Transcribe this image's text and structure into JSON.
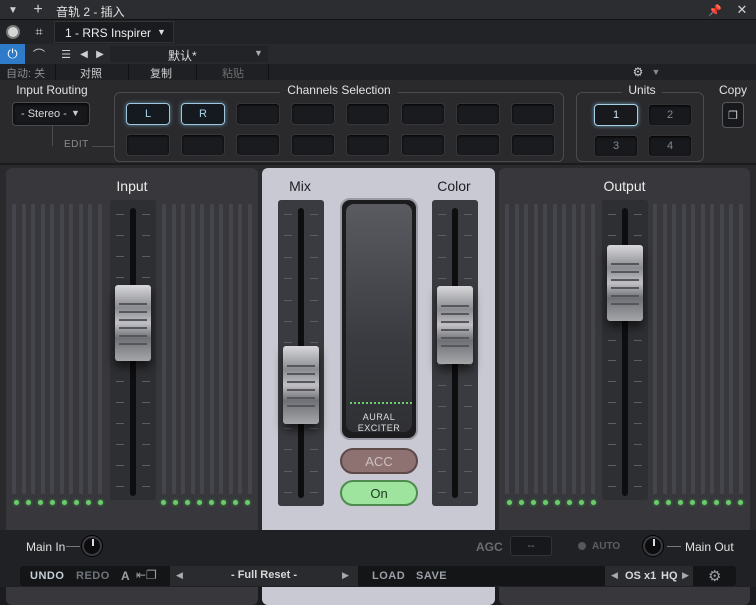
{
  "host": {
    "title": "音轨 2 - 插入",
    "plugin_slot": "1 - RRS Inspirer",
    "preset": "默认*",
    "auto_label": "自动: 关",
    "compare": "对照",
    "copy": "复制",
    "paste": "粘贴"
  },
  "plugin": {
    "input_routing": {
      "label": "Input Routing",
      "value": "- Stereo -",
      "edit": "EDIT"
    },
    "channels": {
      "label": "Channels Selection",
      "row1": [
        "L",
        "R",
        "",
        "",
        "",
        "",
        "",
        ""
      ],
      "row2": [
        "",
        "",
        "",
        "",
        "",
        "",
        "",
        ""
      ],
      "active": [
        "L",
        "R"
      ]
    },
    "units": {
      "label": "Units",
      "items": [
        "1",
        "2",
        "3",
        "4"
      ],
      "active": "1"
    },
    "copy_label": "Copy",
    "input_panel": {
      "title": "Input",
      "fader_level": 0.63
    },
    "mix": {
      "title": "Mix",
      "fader_level": 0.35
    },
    "color": {
      "title": "Color",
      "fader_level": 0.63
    },
    "exciter": {
      "line1": "AURAL",
      "line2": "EXCITER",
      "acc": "ACC",
      "on": "On"
    },
    "output_panel": {
      "title": "Output",
      "fader_level": 0.82
    },
    "main_in": "Main In",
    "agc": {
      "label": "AGC",
      "value": "--",
      "auto": "AUTO"
    },
    "main_out": "Main Out",
    "footer": {
      "undo": "UNDO",
      "redo": "REDO",
      "a": "A",
      "preset": "- Full Reset -",
      "load": "LOAD",
      "save": "SAVE",
      "os": "OS x1",
      "hq": "HQ"
    }
  },
  "colors": {
    "accent": "#9fc7de",
    "meter": "#6ccc6c",
    "center_panel": "#c9c9d4"
  }
}
